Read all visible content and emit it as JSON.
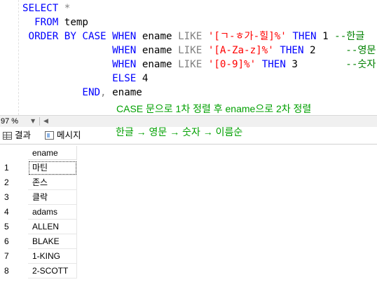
{
  "editor": {
    "lines": [
      [
        {
          "t": "SELECT",
          "c": "kw"
        },
        {
          "t": " *",
          "c": "gr"
        }
      ],
      [
        {
          "t": "  FROM",
          "c": "kw"
        },
        {
          "t": " temp",
          "c": "pl"
        }
      ],
      [
        {
          "t": " ORDER BY CASE WHEN",
          "c": "kw"
        },
        {
          "t": " ename ",
          "c": "pl"
        },
        {
          "t": "LIKE",
          "c": "gr"
        },
        {
          "t": " ",
          "c": "pl"
        },
        {
          "t": "'[ㄱ-ㅎ가-힐]%'",
          "c": "str"
        },
        {
          "t": " THEN",
          "c": "kw"
        },
        {
          "t": " 1 ",
          "c": "pl"
        },
        {
          "t": "--한글",
          "c": "cm"
        }
      ],
      [
        {
          "t": "               WHEN",
          "c": "kw"
        },
        {
          "t": " ename ",
          "c": "pl"
        },
        {
          "t": "LIKE",
          "c": "gr"
        },
        {
          "t": " ",
          "c": "pl"
        },
        {
          "t": "'[A-Za-z]%'",
          "c": "str"
        },
        {
          "t": " THEN",
          "c": "kw"
        },
        {
          "t": " 2     ",
          "c": "pl"
        },
        {
          "t": "--영문",
          "c": "cm"
        }
      ],
      [
        {
          "t": "               WHEN",
          "c": "kw"
        },
        {
          "t": " ename ",
          "c": "pl"
        },
        {
          "t": "LIKE",
          "c": "gr"
        },
        {
          "t": " ",
          "c": "pl"
        },
        {
          "t": "'[0-9]%'",
          "c": "str"
        },
        {
          "t": " THEN",
          "c": "kw"
        },
        {
          "t": " 3        ",
          "c": "pl"
        },
        {
          "t": "--숫자",
          "c": "cm"
        }
      ],
      [
        {
          "t": "               ELSE",
          "c": "kw"
        },
        {
          "t": " 4",
          "c": "pl"
        }
      ],
      [
        {
          "t": "          END",
          "c": "kw"
        },
        {
          "t": ",",
          "c": "gr"
        },
        {
          "t": " ename",
          "c": "pl"
        }
      ]
    ],
    "annotation": "CASE 문으로 1차 정렬 후 ename으로 2차 정렬"
  },
  "scrollbar": {
    "zoom": "97 %",
    "zoom_arrow": "▼",
    "left_arrow": "◀"
  },
  "tabs": {
    "results": "결과",
    "messages": "메시지",
    "results_icon": "grid-icon",
    "messages_icon": "message-icon"
  },
  "annotation2": "한글 → 영문 → 숫자 → 이름순",
  "results": {
    "columns": [
      "ename"
    ],
    "rows": [
      {
        "num": "1",
        "ename": "마틴"
      },
      {
        "num": "2",
        "ename": "존스"
      },
      {
        "num": "3",
        "ename": "클락"
      },
      {
        "num": "4",
        "ename": "adams"
      },
      {
        "num": "5",
        "ename": "ALLEN"
      },
      {
        "num": "6",
        "ename": "BLAKE"
      },
      {
        "num": "7",
        "ename": "1-KING"
      },
      {
        "num": "8",
        "ename": "2-SCOTT"
      }
    ]
  }
}
